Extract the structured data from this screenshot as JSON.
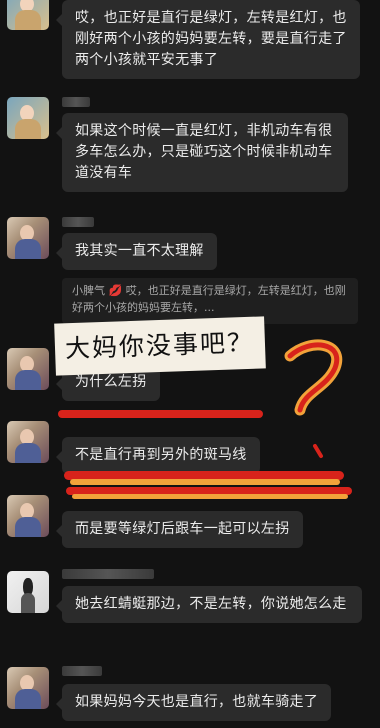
{
  "messages": [
    {
      "text": "哎，也正好是直行是绿灯，左转是红灯，也刚好两个小孩的妈妈要左转，要是直行走了两个小孩就平安无事了"
    },
    {
      "text": "如果这个时候一直是红灯，非机动车有很多车怎么办，只是碰巧这个时候非机动车道没有车"
    },
    {
      "text": "我其实一直不太理解"
    },
    {
      "text": "为什么左拐"
    },
    {
      "text": "不是直行再到另外的斑马线"
    },
    {
      "text": "而是要等绿灯后跟车一起可以左拐"
    },
    {
      "text": "她去红蜻蜓那边，不是左转，你说她怎么走"
    },
    {
      "text": "如果妈妈今天也是直行，也就车骑走了"
    }
  ],
  "quote": {
    "sender": "小脾气",
    "emoji": "💋",
    "text": "哎，也正好是直行是绿灯，左转是红灯，也刚好两个小孩的妈妈要左转，..."
  },
  "annotation": {
    "text": "大妈你没事吧？"
  },
  "colors": {
    "red": "#d8231b",
    "orange": "#f2a23a",
    "bubble": "#2b2b2b",
    "background": "#121212"
  }
}
